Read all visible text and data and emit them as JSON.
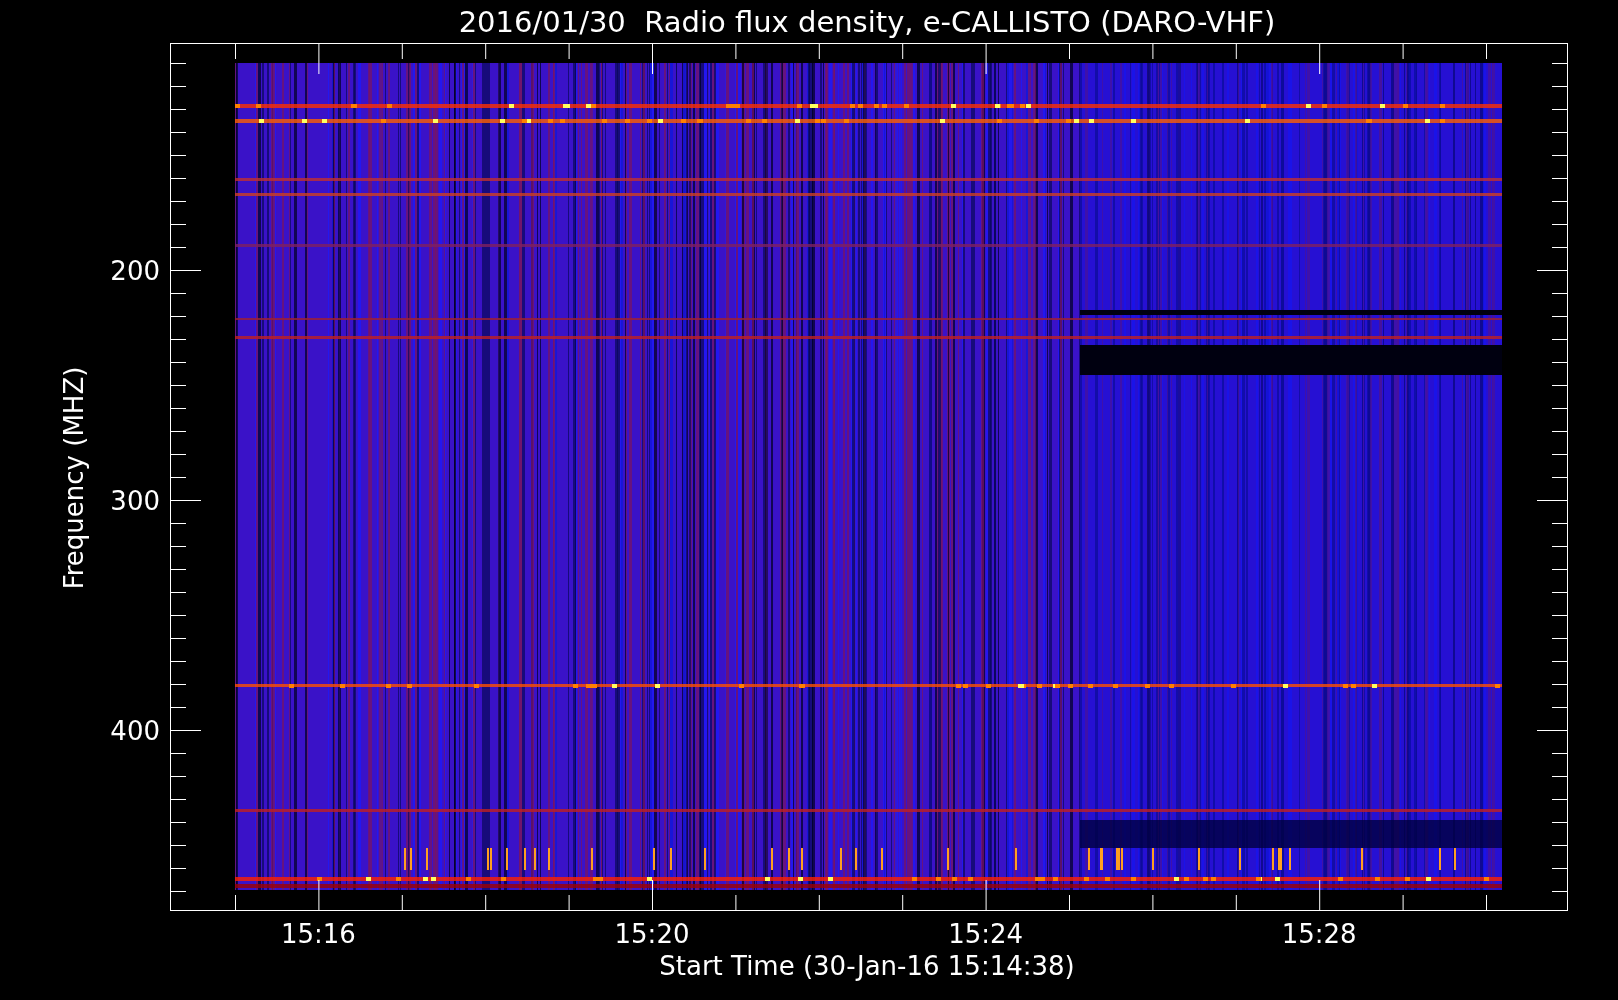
{
  "title": "2016/01/30  Radio flux density, e-CALLISTO (DARO-VHF)",
  "y_axis": {
    "title": "Frequency (MHZ)",
    "tick_labels": [
      "200",
      "300",
      "400"
    ]
  },
  "x_axis": {
    "title": "Start Time (30-Jan-16 15:14:38)",
    "tick_labels": [
      "15:16",
      "15:20",
      "15:24",
      "15:28"
    ]
  }
}
